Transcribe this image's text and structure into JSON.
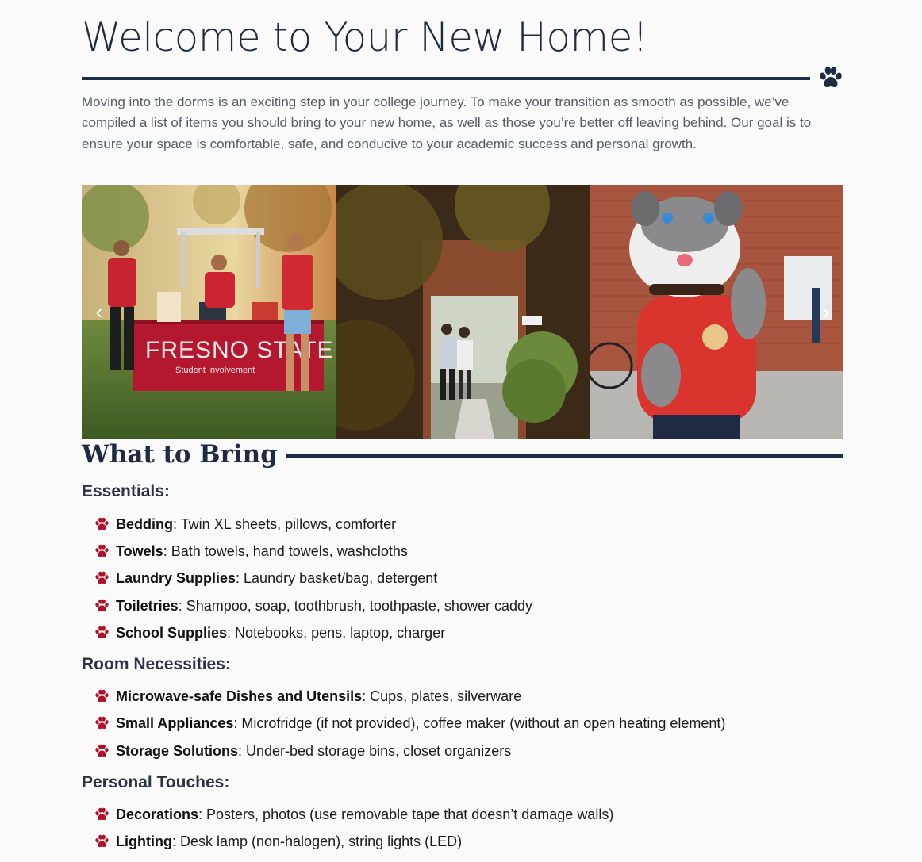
{
  "hero": {
    "title": "Welcome to Your New Home!",
    "intro": "Moving into the dorms is an exciting step in your college journey. To make your transition as smooth as possible, we’ve compiled a list of items you should bring to your new home, as well as those you’re better off leaving behind. Our goal is to ensure your space is comfortable, safe, and conducive to your academic success and personal growth."
  },
  "carousel": {
    "prev_icon": "chevron-left-icon",
    "next_icon": "chevron-right-icon",
    "slide1": {
      "banner_text": "FRESNO STATE",
      "banner_sub": "Student Involvement"
    }
  },
  "section": {
    "title": "What to Bring",
    "groups": [
      {
        "heading": "Essentials:",
        "items": [
          {
            "label": "Bedding",
            "text": ": Twin XL sheets, pillows, comforter"
          },
          {
            "label": "Towels",
            "text": ": Bath towels, hand towels, washcloths"
          },
          {
            "label": "Laundry Supplies",
            "text": ": Laundry basket/bag, detergent"
          },
          {
            "label": "Toiletries",
            "text": ": Shampoo, soap, toothbrush, toothpaste, shower caddy"
          },
          {
            "label": "School Supplies",
            "text": ": Notebooks, pens, laptop, charger"
          }
        ]
      },
      {
        "heading": "Room Necessities:",
        "items": [
          {
            "label": "Microwave-safe Dishes and Utensils",
            "text": ": Cups, plates, silverware"
          },
          {
            "label": "Small Appliances",
            "text": ": Microfridge (if not provided), coffee maker (without an open heating element)"
          },
          {
            "label": "Storage Solutions",
            "text": ": Under-bed storage bins, closet organizers"
          }
        ]
      },
      {
        "heading": "Personal Touches:",
        "items": [
          {
            "label": "Decorations",
            "text": ": Posters, photos (use removable tape that doesn’t damage walls)"
          },
          {
            "label": "Lighting",
            "text": ": Desk lamp (non-halogen), string lights (LED)"
          }
        ]
      }
    ]
  },
  "colors": {
    "navy": "#1f2a44",
    "paw_red": "#b1102b",
    "body_text": "#555b66"
  }
}
